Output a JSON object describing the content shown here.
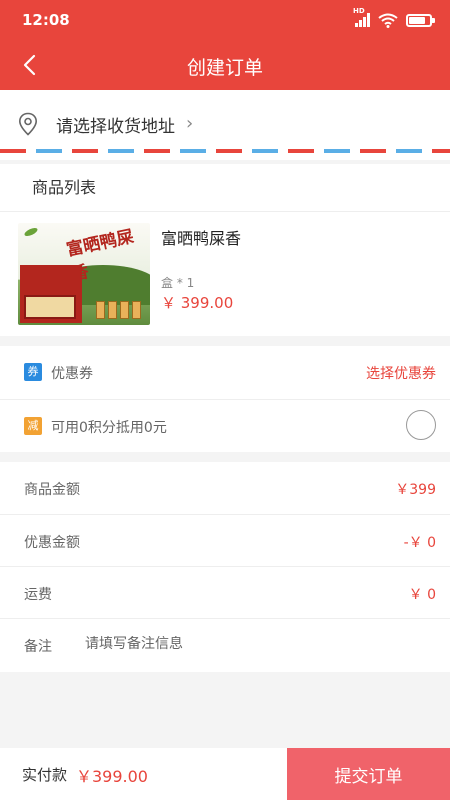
{
  "status_bar": {
    "time": "12:08",
    "hd_badge": "HD"
  },
  "nav": {
    "title": "创建订单"
  },
  "address": {
    "placeholder": "请选择收货地址"
  },
  "goods": {
    "section_title": "商品列表",
    "items": [
      {
        "name": "富晒鸭屎香",
        "image_text": "富晒鸭屎香",
        "qty": "盒 * 1",
        "price": "￥ 399.00"
      }
    ]
  },
  "discounts": {
    "coupon": {
      "tag": "券",
      "label": "优惠券",
      "action": "选择优惠券"
    },
    "points": {
      "tag": "减",
      "label": "可用0积分抵用0元",
      "checked": false
    }
  },
  "summary": {
    "goods_amount": {
      "label": "商品金额",
      "value": "￥399"
    },
    "discount_amount": {
      "label": "优惠金额",
      "value": "-￥ 0"
    },
    "shipping": {
      "label": "运费",
      "value": "￥ 0"
    },
    "remark": {
      "label": "备注",
      "placeholder": "请填写备注信息"
    }
  },
  "bottom": {
    "total_label": "实付款",
    "total": "￥399.00",
    "submit": "提交订单"
  },
  "colors": {
    "primary": "#e8453c",
    "submit": "#f0636a",
    "coupon_tag": "#2a8bdf",
    "points_tag": "#f2a233"
  }
}
